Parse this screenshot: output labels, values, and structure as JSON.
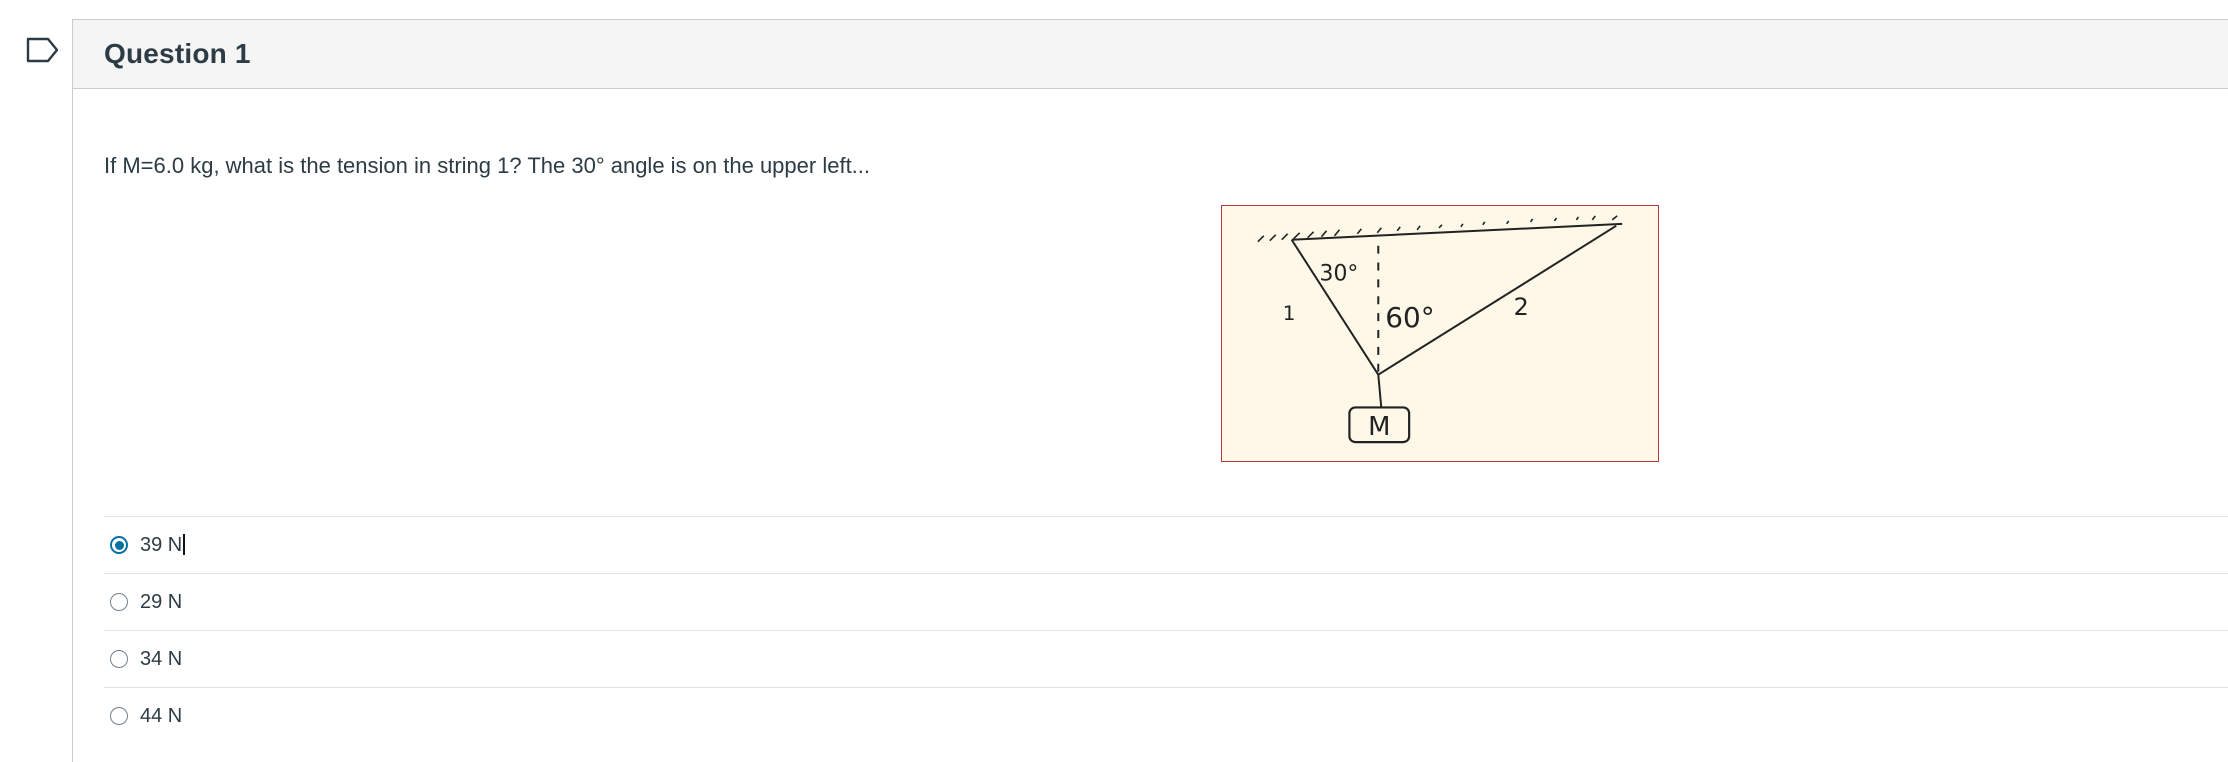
{
  "question": {
    "title": "Question 1",
    "text": "If M=6.0 kg, what is the tension in string 1? The 30° angle is on the upper left..."
  },
  "figure": {
    "angle_left_label": "30°",
    "angle_right_label": "60°",
    "string1_label": "1",
    "string2_label": "2",
    "mass_label": "M"
  },
  "answers": [
    {
      "label": "39 N",
      "selected": true
    },
    {
      "label": "29 N",
      "selected": false
    },
    {
      "label": "34 N",
      "selected": false
    },
    {
      "label": "44 N",
      "selected": false
    }
  ],
  "colors": {
    "accent": "#0770a3",
    "text": "#2d3b45",
    "header_bg": "#f5f5f5",
    "border": "#c7cdd1",
    "figure_border": "#b83a3a"
  }
}
